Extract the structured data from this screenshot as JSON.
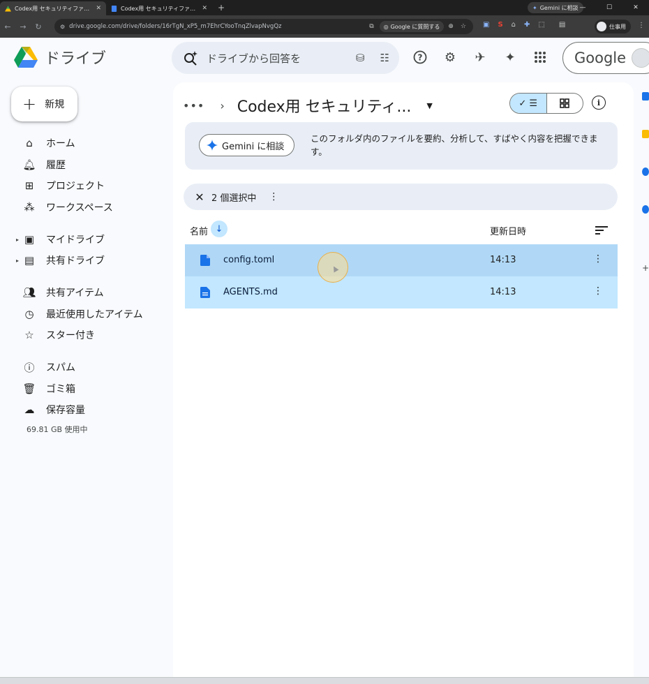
{
  "browser": {
    "tabs": [
      {
        "title": "Codex用 セキュリティファイル - Goo",
        "active": true
      },
      {
        "title": "Codex用 セキュリティファイル設定マ",
        "active": false
      }
    ],
    "gemini_button": "Gemini に相談",
    "url": "drive.google.com/drive/folders/16rTgN_xP5_m7EhrCYooTnqZlvapNvgQz",
    "ask_google": "Google に質問する",
    "profile_label": "仕事用"
  },
  "header": {
    "app_name": "ドライブ",
    "search_placeholder": "ドライブから回答を",
    "google_label": "Google"
  },
  "sidebar": {
    "new_label": "新規",
    "items": [
      {
        "label": "ホーム",
        "icon": "home-icon"
      },
      {
        "label": "履歴",
        "icon": "bell-icon"
      },
      {
        "label": "プロジェクト",
        "icon": "project-icon"
      },
      {
        "label": "ワークスペース",
        "icon": "workspace-icon"
      },
      {
        "label": "マイドライブ",
        "icon": "my-drive-icon"
      },
      {
        "label": "共有ドライブ",
        "icon": "shared-drive-icon"
      },
      {
        "label": "共有アイテム",
        "icon": "people-icon"
      },
      {
        "label": "最近使用したアイテム",
        "icon": "clock-icon"
      },
      {
        "label": "スター付き",
        "icon": "star-icon"
      },
      {
        "label": "スパム",
        "icon": "spam-icon"
      },
      {
        "label": "ゴミ箱",
        "icon": "trash-icon"
      },
      {
        "label": "保存容量",
        "icon": "cloud-icon"
      }
    ],
    "storage_used": "69.81 GB 使用中"
  },
  "main": {
    "breadcrumb_more": "•••",
    "folder_title": "Codex用 セキュリティ...",
    "gemini_card": {
      "button_label": "Gemini に相談",
      "description": "このフォルダ内のファイルを要約、分析して、すばやく内容を把握できます。"
    },
    "selection": {
      "count_label": "2 個選択中"
    },
    "columns": {
      "name": "名前",
      "modified": "更新日時"
    },
    "files": [
      {
        "name": "config.toml",
        "modified": "14:13"
      },
      {
        "name": "AGENTS.md",
        "modified": "14:13"
      }
    ]
  },
  "colors": {
    "accent": "#0b57d0",
    "selected_row": "#c2e7ff",
    "surface": "#e9eef6"
  }
}
